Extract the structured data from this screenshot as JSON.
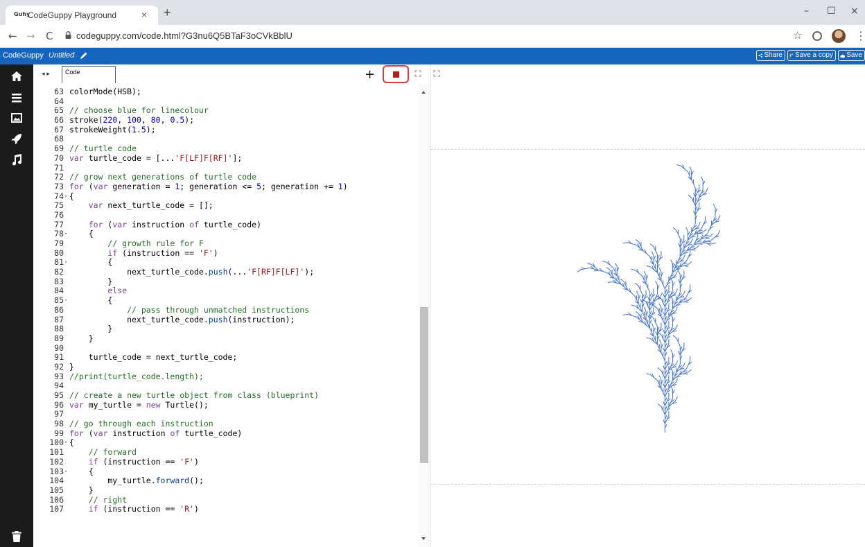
{
  "browser": {
    "tab_title": "CodeGuppy Playground",
    "favicon_text": "Guhy",
    "new_tab": "+",
    "close_tab": "×",
    "url": "codeguppy.com/code.html?G3nu6Q5BTaF3oCVkBblU",
    "window_controls": {
      "minimize": "–",
      "maximize": "☐",
      "close": "×"
    },
    "nav": {
      "back": "←",
      "forward": "→",
      "reload": "C"
    },
    "star": "☆",
    "menu": "⋮"
  },
  "app": {
    "brand": "CodeGuppy",
    "doc_title": "Untitled",
    "buttons": {
      "share": "Share",
      "save_copy": "Save a copy",
      "save": "Save"
    },
    "accent_color": "#1565c0"
  },
  "sidebar": {
    "icons": [
      "home-icon",
      "list-icon",
      "image-icon",
      "rocket-icon",
      "music-icon",
      "trash-icon"
    ]
  },
  "editor": {
    "tab_label": "Code",
    "nav_arrows": "◂ ▸",
    "add": "+",
    "lines": [
      {
        "n": "63",
        "fold": false,
        "t": [
          [
            "colorMode(HSB);",
            ""
          ]
        ]
      },
      {
        "n": "64",
        "fold": false,
        "t": []
      },
      {
        "n": "65",
        "fold": false,
        "t": [
          [
            "// choose blue for linecolour",
            "c"
          ]
        ]
      },
      {
        "n": "66",
        "fold": false,
        "t": [
          [
            "stroke(",
            ""
          ],
          [
            "220",
            "n"
          ],
          [
            ", ",
            ""
          ],
          [
            "100",
            "n"
          ],
          [
            ", ",
            ""
          ],
          [
            "80",
            "n"
          ],
          [
            ", ",
            ""
          ],
          [
            "0.5",
            "n"
          ],
          [
            ");",
            ""
          ]
        ]
      },
      {
        "n": "67",
        "fold": false,
        "t": [
          [
            "strokeWeight(",
            ""
          ],
          [
            "1.5",
            "n"
          ],
          [
            ");",
            ""
          ]
        ]
      },
      {
        "n": "68",
        "fold": false,
        "t": []
      },
      {
        "n": "69",
        "fold": false,
        "t": [
          [
            "// turtle code",
            "c"
          ]
        ]
      },
      {
        "n": "70",
        "fold": false,
        "t": [
          [
            "var",
            "k"
          ],
          [
            " turtle_code = [...",
            ""
          ],
          [
            "'F[LF]F[RF]'",
            "s"
          ],
          [
            "];",
            ""
          ]
        ]
      },
      {
        "n": "71",
        "fold": false,
        "t": []
      },
      {
        "n": "72",
        "fold": false,
        "t": [
          [
            "// grow next generations of turtle code",
            "c"
          ]
        ]
      },
      {
        "n": "73",
        "fold": false,
        "t": [
          [
            "for",
            "k"
          ],
          [
            " (",
            ""
          ],
          [
            "var",
            "k"
          ],
          [
            " generation = ",
            ""
          ],
          [
            "1",
            "n"
          ],
          [
            "; generation <= ",
            ""
          ],
          [
            "5",
            "n"
          ],
          [
            "; generation += ",
            ""
          ],
          [
            "1",
            "n"
          ],
          [
            ")",
            ""
          ]
        ]
      },
      {
        "n": "74",
        "fold": true,
        "t": [
          [
            "{",
            ""
          ]
        ]
      },
      {
        "n": "75",
        "fold": false,
        "t": [
          [
            "    ",
            ""
          ],
          [
            "var",
            "k"
          ],
          [
            " next_turtle_code = [];",
            ""
          ]
        ]
      },
      {
        "n": "76",
        "fold": false,
        "t": []
      },
      {
        "n": "77",
        "fold": false,
        "t": [
          [
            "    ",
            ""
          ],
          [
            "for",
            "k"
          ],
          [
            " (",
            ""
          ],
          [
            "var",
            "k"
          ],
          [
            " instruction ",
            ""
          ],
          [
            "of",
            "k"
          ],
          [
            " turtle_code)",
            ""
          ]
        ]
      },
      {
        "n": "78",
        "fold": true,
        "t": [
          [
            "    {",
            ""
          ]
        ]
      },
      {
        "n": "79",
        "fold": false,
        "t": [
          [
            "        ",
            ""
          ],
          [
            "// growth rule for F",
            "c"
          ]
        ]
      },
      {
        "n": "80",
        "fold": false,
        "t": [
          [
            "        ",
            ""
          ],
          [
            "if",
            "k"
          ],
          [
            " (instruction == ",
            ""
          ],
          [
            "'F'",
            "s"
          ],
          [
            ")",
            ""
          ]
        ]
      },
      {
        "n": "81",
        "fold": true,
        "t": [
          [
            "        {",
            ""
          ]
        ]
      },
      {
        "n": "82",
        "fold": false,
        "t": [
          [
            "            next_turtle_code.",
            ""
          ],
          [
            "push",
            "f"
          ],
          [
            "(...",
            ""
          ],
          [
            "'F[RF]F[LF]'",
            "s"
          ],
          [
            ");",
            ""
          ]
        ]
      },
      {
        "n": "83",
        "fold": false,
        "t": [
          [
            "        }",
            ""
          ]
        ]
      },
      {
        "n": "84",
        "fold": false,
        "t": [
          [
            "        ",
            ""
          ],
          [
            "else",
            "k"
          ]
        ]
      },
      {
        "n": "85",
        "fold": true,
        "t": [
          [
            "        {",
            ""
          ]
        ]
      },
      {
        "n": "86",
        "fold": false,
        "t": [
          [
            "            ",
            ""
          ],
          [
            "// pass through unmatched instructions",
            "c"
          ]
        ]
      },
      {
        "n": "87",
        "fold": false,
        "t": [
          [
            "            next_turtle_code.",
            ""
          ],
          [
            "push",
            "f"
          ],
          [
            "(instruction);",
            ""
          ]
        ]
      },
      {
        "n": "88",
        "fold": false,
        "t": [
          [
            "        }",
            ""
          ]
        ]
      },
      {
        "n": "89",
        "fold": false,
        "t": [
          [
            "    }",
            ""
          ]
        ]
      },
      {
        "n": "90",
        "fold": false,
        "t": []
      },
      {
        "n": "91",
        "fold": false,
        "t": [
          [
            "    turtle_code = next_turtle_code;",
            ""
          ]
        ]
      },
      {
        "n": "92",
        "fold": false,
        "t": [
          [
            "}",
            ""
          ]
        ]
      },
      {
        "n": "93",
        "fold": false,
        "t": [
          [
            "//print(turtle_code.length);",
            "c"
          ]
        ]
      },
      {
        "n": "94",
        "fold": false,
        "t": []
      },
      {
        "n": "95",
        "fold": false,
        "t": [
          [
            "// create a new turtle object from class (blueprint)",
            "c"
          ]
        ]
      },
      {
        "n": "96",
        "fold": false,
        "t": [
          [
            "var",
            "k"
          ],
          [
            " my_turtle = ",
            ""
          ],
          [
            "new",
            "k"
          ],
          [
            " Turtle();",
            ""
          ]
        ]
      },
      {
        "n": "97",
        "fold": false,
        "t": []
      },
      {
        "n": "98",
        "fold": false,
        "t": [
          [
            "// go through each instruction",
            "c"
          ]
        ]
      },
      {
        "n": "99",
        "fold": false,
        "t": [
          [
            "for",
            "k"
          ],
          [
            " (",
            ""
          ],
          [
            "var",
            "k"
          ],
          [
            " instruction ",
            ""
          ],
          [
            "of",
            "k"
          ],
          [
            " turtle_code)",
            ""
          ]
        ]
      },
      {
        "n": "100",
        "fold": true,
        "t": [
          [
            "{",
            ""
          ]
        ]
      },
      {
        "n": "101",
        "fold": false,
        "t": [
          [
            "    ",
            ""
          ],
          [
            "// forward",
            "c"
          ]
        ]
      },
      {
        "n": "102",
        "fold": false,
        "t": [
          [
            "    ",
            ""
          ],
          [
            "if",
            "k"
          ],
          [
            " (instruction == ",
            ""
          ],
          [
            "'F'",
            "s"
          ],
          [
            ")",
            ""
          ]
        ]
      },
      {
        "n": "103",
        "fold": true,
        "t": [
          [
            "    {",
            ""
          ]
        ]
      },
      {
        "n": "104",
        "fold": false,
        "t": [
          [
            "        my_turtle.",
            ""
          ],
          [
            "forward",
            "f"
          ],
          [
            "();",
            ""
          ]
        ]
      },
      {
        "n": "105",
        "fold": false,
        "t": [
          [
            "    }",
            ""
          ]
        ]
      },
      {
        "n": "106",
        "fold": false,
        "t": [
          [
            "    ",
            ""
          ],
          [
            "// right",
            "c"
          ]
        ]
      },
      {
        "n": "107",
        "fold": false,
        "t": [
          [
            "    ",
            ""
          ],
          [
            "if",
            "k"
          ],
          [
            " (instruction == ",
            ""
          ],
          [
            "'R'",
            "s"
          ],
          [
            ")",
            ""
          ]
        ]
      }
    ]
  },
  "output": {
    "plant_color": "#2f63cf",
    "generations": 5,
    "axiom": "F[LF]F[RF]",
    "rule_F": "F[RF]F[LF]"
  }
}
